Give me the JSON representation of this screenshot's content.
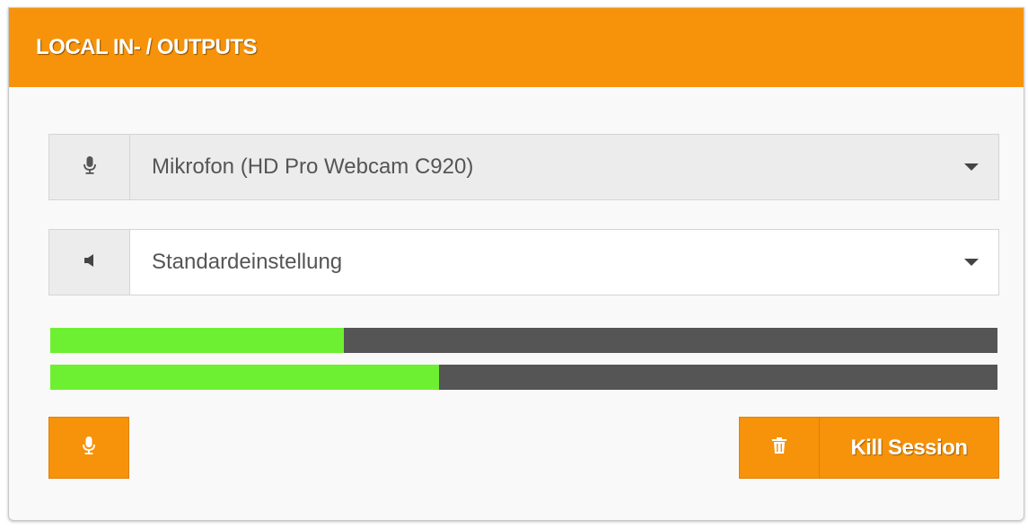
{
  "panel": {
    "title": "LOCAL IN- / OUTPUTS",
    "accent_color": "#f7930a"
  },
  "microphone_select": {
    "icon": "microphone-icon",
    "selected": "Mikrofon (HD Pro Webcam C920)"
  },
  "speaker_select": {
    "icon": "speaker-icon",
    "selected": "Standardeinstellung"
  },
  "level_meters": [
    {
      "name": "input",
      "level_percent": 31,
      "fill_color": "#6ef032"
    },
    {
      "name": "output",
      "level_percent": 41,
      "fill_color": "#6ef032"
    }
  ],
  "buttons": {
    "mic_toggle_icon": "microphone-icon",
    "kill_session_icon": "trash-icon",
    "kill_session_label": "Kill Session"
  }
}
